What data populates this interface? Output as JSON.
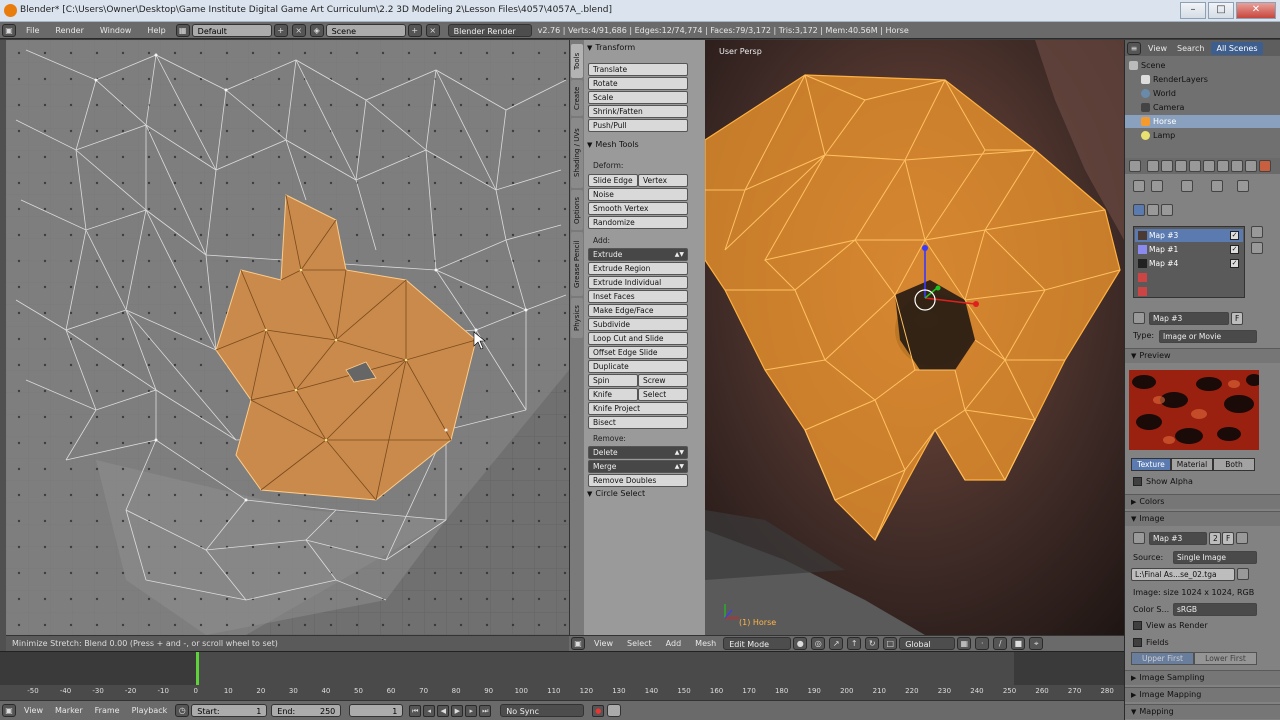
{
  "window": {
    "title": "Blender* [C:\\Users\\Owner\\Desktop\\Game Institute Digital Game Art  Curriculum\\2.2 3D Modeling 2\\Lesson Files\\4057\\4057A_.blend]",
    "minimize": "–",
    "maximize": "□",
    "close": "✕"
  },
  "infobar": {
    "menus": [
      "File",
      "Render",
      "Window",
      "Help"
    ],
    "layout": "Default",
    "scene": "Scene",
    "engine": "Blender Render",
    "stats": "v2.76 | Verts:4/91,686 | Edges:12/74,774 | Faces:79/3,172 | Tris:3,172 | Mem:40.56M | Horse"
  },
  "uv_editor": {
    "status": "Minimize Stretch: Blend 0.00 (Press + and -, or scroll wheel to set)"
  },
  "tool_tabs": [
    "Tools",
    "Create",
    "Shading / UVs",
    "Options",
    "Grease Pencil",
    "Physics"
  ],
  "toolshelf": {
    "transform_header": "Transform",
    "transform": [
      "Translate",
      "Rotate",
      "Scale",
      "Shrink/Fatten",
      "Push/Pull"
    ],
    "mesh_tools_header": "Mesh Tools",
    "deform_label": "Deform:",
    "slide_edge": "Slide Edge",
    "vertex": "Vertex",
    "noise": "Noise",
    "smooth_vertex": "Smooth Vertex",
    "randomize": "Randomize",
    "add_label": "Add:",
    "extrude": "Extrude",
    "extrude_region": "Extrude Region",
    "extrude_individual": "Extrude Individual",
    "inset_faces": "Inset Faces",
    "make_edge_face": "Make Edge/Face",
    "subdivide": "Subdivide",
    "loop_cut": "Loop Cut and Slide",
    "offset_edge": "Offset Edge Slide",
    "duplicate": "Duplicate",
    "spin": "Spin",
    "screw": "Screw",
    "knife": "Knife",
    "select": "Select",
    "knife_project": "Knife Project",
    "bisect": "Bisect",
    "remove_label": "Remove:",
    "delete": "Delete",
    "merge": "Merge",
    "remove_doubles": "Remove Doubles",
    "circle_select_header": "Circle Select"
  },
  "viewport": {
    "label": "User Persp",
    "object": "(1) Horse",
    "menus": [
      "View",
      "Select",
      "Add",
      "Mesh"
    ],
    "mode": "Edit Mode",
    "orientation": "Global"
  },
  "outliner": {
    "menus": [
      "View",
      "Search"
    ],
    "all_scenes": "All Scenes",
    "items": [
      "Scene",
      "RenderLayers",
      "World",
      "Camera",
      "Horse",
      "Lamp"
    ]
  },
  "properties": {
    "textures": [
      {
        "name": "Map #3",
        "color": "#4b3a33"
      },
      {
        "name": "Map #1",
        "color": "#8a8af0"
      },
      {
        "name": "Map #4",
        "color": "#222222"
      }
    ],
    "texture_name": "Map #3",
    "fake_user": "F",
    "type_label": "Type:",
    "type_value": "Image or Movie",
    "preview_header": "Preview",
    "preview_tabs": [
      "Texture",
      "Material",
      "Both"
    ],
    "show_alpha": "Show Alpha",
    "colors_header": "Colors",
    "image_header": "Image",
    "image_name": "Map #3",
    "image_users": "2",
    "source_label": "Source:",
    "source_value": "Single Image",
    "filepath": "L:\\Final As...se_02.tga",
    "image_info": "Image: size 1024 x 1024, RGB",
    "colorspace_label": "Color S...",
    "colorspace_value": "sRGB",
    "view_as_render": "View as Render",
    "fields": "Fields",
    "field_order": [
      "Upper First",
      "Lower First"
    ],
    "image_sampling": "Image Sampling",
    "image_mapping": "Image Mapping",
    "mapping": "Mapping"
  },
  "timeline": {
    "ruler": [
      "-50",
      "-40",
      "-30",
      "-20",
      "-10",
      "0",
      "10",
      "20",
      "30",
      "40",
      "50",
      "60",
      "70",
      "80",
      "90",
      "100",
      "110",
      "120",
      "130",
      "140",
      "150",
      "160",
      "170",
      "180",
      "190",
      "200",
      "210",
      "220",
      "230",
      "240",
      "250",
      "260",
      "270",
      "280"
    ],
    "menus": [
      "View",
      "Marker",
      "Frame",
      "Playback"
    ],
    "start_label": "Start:",
    "start": "1",
    "end_label": "End:",
    "end": "250",
    "current": "1",
    "sync": "No Sync"
  },
  "colors": {
    "selection_orange": "#e8943a",
    "selected_blue": "#5a7ab0"
  }
}
